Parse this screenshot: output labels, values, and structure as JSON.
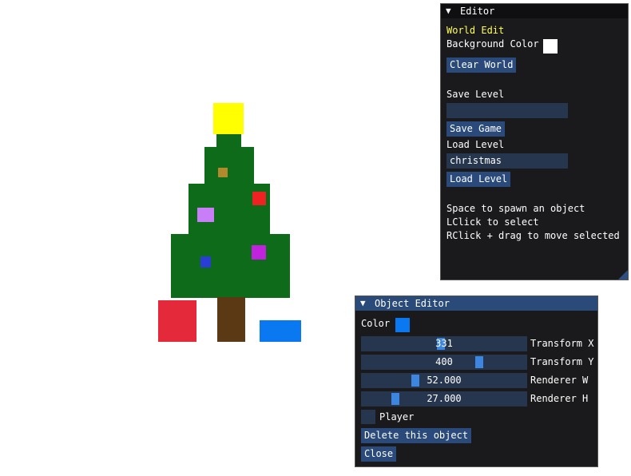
{
  "scene": {
    "colors": {
      "star": "#ffff00",
      "tree": "#0e6b1a",
      "trunk": "#5a3914",
      "gift_red": "#e42a3a",
      "gift_blue": "#0a78f0",
      "ornament_gold": "#b28a2c",
      "ornament_red": "#ee2222",
      "ornament_lilac": "#c77ef6",
      "ornament_magenta": "#c022dd",
      "ornament_blue": "#2a3ed6"
    }
  },
  "editor": {
    "title": "Editor",
    "section_title": "World Edit",
    "background_color_label": "Background Color",
    "background_color_value": "#ffffff",
    "clear_world_label": "Clear World",
    "save_level_label": "Save Level",
    "save_level_value": "",
    "save_game_label": "Save Game",
    "load_level_label": "Load Level",
    "load_level_value": "christmas",
    "load_level_button": "Load Level",
    "help": [
      "Space to spawn an object",
      "LClick to select",
      "RClick + drag to move selected"
    ]
  },
  "object_editor": {
    "title": "Object Editor",
    "color_label": "Color",
    "color_value": "#0a78f0",
    "fields": [
      {
        "value": "331",
        "label": "Transform X",
        "fill": 0.48
      },
      {
        "value": "400",
        "label": "Transform Y",
        "fill": 0.72
      },
      {
        "value": "52.000",
        "label": "Renderer W",
        "fill": 0.32
      },
      {
        "value": "27.000",
        "label": "Renderer H",
        "fill": 0.19
      }
    ],
    "player_label": "Player",
    "player_checked": false,
    "delete_label": "Delete this object",
    "close_label": "Close"
  }
}
